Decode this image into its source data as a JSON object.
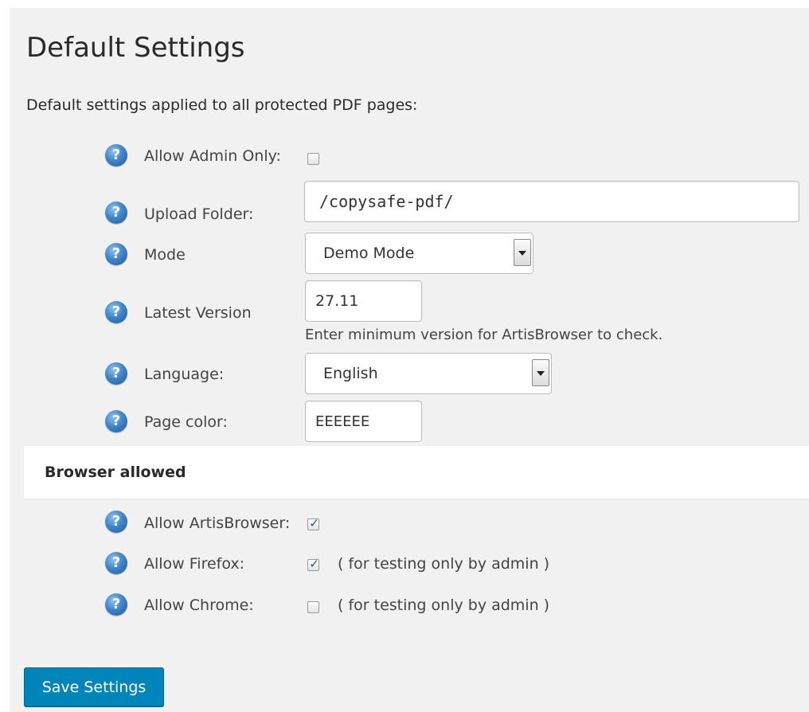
{
  "page": {
    "title": "Default Settings",
    "subtitle": "Default settings applied to all protected PDF pages:"
  },
  "fields": {
    "allow_admin_only": {
      "label": "Allow Admin Only:",
      "checked": false
    },
    "upload_folder": {
      "label": "Upload Folder:",
      "value": "/copysafe-pdf/"
    },
    "mode": {
      "label": "Mode",
      "selected": "Demo Mode"
    },
    "latest_version": {
      "label": "Latest Version",
      "value": "27.11",
      "hint": "Enter minimum version for ArtisBrowser to check."
    },
    "language": {
      "label": "Language:",
      "selected": "English"
    },
    "page_color": {
      "label": "Page color:",
      "value": "EEEEEE"
    }
  },
  "browser_section": {
    "heading": "Browser allowed",
    "allow_artisbrowser": {
      "label": "Allow ArtisBrowser:",
      "checked": true
    },
    "allow_firefox": {
      "label": "Allow Firefox:",
      "checked": true,
      "note": "( for testing only by admin )"
    },
    "allow_chrome": {
      "label": "Allow Chrome:",
      "checked": false,
      "note": "( for testing only by admin )"
    }
  },
  "help_icon_glyph": "?",
  "checkmark_glyph": "✓",
  "save_button": {
    "label": "Save Settings"
  },
  "colors": {
    "background": "#f1f1f1",
    "primary_button": "#0085ba",
    "help_icon": "#3f86c9"
  }
}
